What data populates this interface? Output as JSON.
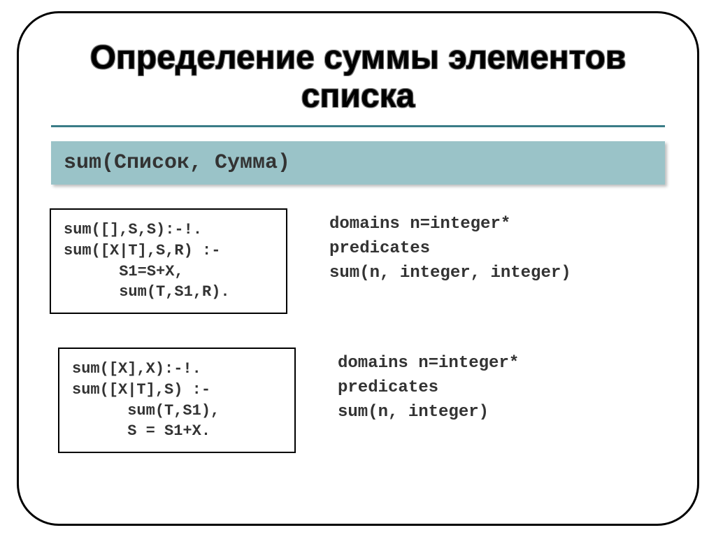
{
  "title": "Определение суммы элементов списка",
  "signature": "sum(Список, Сумма)",
  "block1": {
    "code": "sum([],S,S):-!.\nsum([X|T],S,R) :-\n      S1=S+X,\n      sum(T,S1,R).",
    "decl": "domains n=integer*\npredicates\nsum(n, integer, integer)"
  },
  "block2": {
    "code": "sum([X],X):-!.\nsum([X|T],S) :-\n      sum(T,S1),\n      S = S1+X.",
    "decl": "domains n=integer*\npredicates\nsum(n, integer)"
  }
}
